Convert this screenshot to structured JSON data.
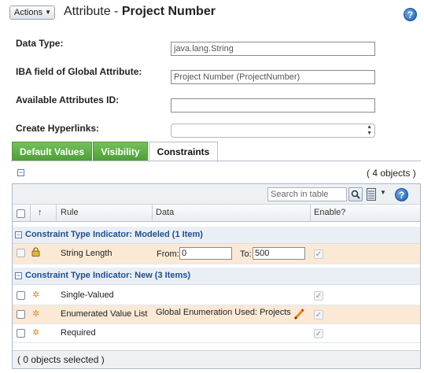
{
  "header": {
    "actions_label": "Actions",
    "title_prefix": "Attribute - ",
    "title_name": "Project Number",
    "help_glyph": "?"
  },
  "form": {
    "data_type_label": "Data Type:",
    "data_type_value": "java.lang.String",
    "iba_label": "IBA field of Global Attribute:",
    "iba_value": "Project Number (ProjectNumber)",
    "available_id_label": "Available Attributes ID:",
    "available_id_value": "",
    "hyperlinks_label": "Create Hyperlinks:",
    "hyperlinks_value": ""
  },
  "tabs": [
    {
      "label": "Default Values",
      "active": false
    },
    {
      "label": "Visibility",
      "active": false
    },
    {
      "label": "Constraints",
      "active": true
    }
  ],
  "table": {
    "object_count": "( 4 objects )",
    "search_placeholder": "Search in table",
    "columns": {
      "sort": "↑",
      "rule": "Rule",
      "data": "Data",
      "enable": "Enable?"
    },
    "groups": [
      {
        "title": "Constraint Type Indicator: Modeled (1 Item)",
        "rows": [
          {
            "icon": "lock-icon",
            "rule": "String Length",
            "from_label": "From:",
            "from_value": "0",
            "to_label": "To:",
            "to_value": "500",
            "enabled": true
          }
        ]
      },
      {
        "title": "Constraint Type Indicator: New (3 Items)",
        "rows": [
          {
            "icon": "new-star-icon",
            "rule": "Single-Valued",
            "data": "",
            "enabled": true
          },
          {
            "icon": "new-star-icon",
            "rule": "Enumerated Value List",
            "data": "Global Enumeration Used: Projects",
            "enabled": true
          },
          {
            "icon": "new-star-icon",
            "rule": "Required",
            "data": "",
            "enabled": true
          }
        ]
      }
    ],
    "footer": "( 0 objects selected )"
  },
  "colors": {
    "tab_green": "#4e9f37",
    "highlight_row": "#fbe9d6",
    "group_title": "#1e4f8f"
  }
}
